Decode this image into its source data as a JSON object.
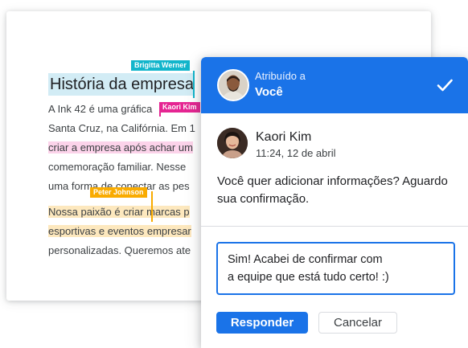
{
  "document": {
    "title": "História da empresa",
    "lines": [
      {
        "normal": "A Ink 42 é uma gráfica",
        "highlight": ""
      },
      {
        "normal": "Santa Cruz, na Califórnia. Em 1",
        "highlight": ""
      },
      {
        "normal": "",
        "highlight": "criar a empresa após achar um"
      },
      {
        "normal": "comemoração familiar. Nesse",
        "highlight": ""
      },
      {
        "normal": "uma forma de conectar as pes",
        "highlight": ""
      },
      {
        "highlight_pre": "Nossa paixão é criar",
        "highlight_post": "marcas p"
      },
      {
        "highlight": "esportivas e eventos empresar"
      },
      {
        "normal": "personalizadas. Queremos ate"
      }
    ],
    "collaborators": [
      {
        "name": "Brigitta Werner",
        "color": "#12b5cb"
      },
      {
        "name": "Kaori Kim",
        "color": "#e52592"
      },
      {
        "name": "Peter Johnson",
        "color": "#f9ab00"
      }
    ]
  },
  "panel": {
    "assigned_label": "Atribuído a",
    "assigned_to": "Você",
    "comment": {
      "author": "Kaori Kim",
      "time": "11:24, 12 de abril",
      "text": "Você quer adicionar informações? Aguardo sua confirmação."
    },
    "reply_text": "Sim! Acabei de confirmar com\na equipe que está tudo certo! :)",
    "reply_button": "Responder",
    "cancel_button": "Cancelar",
    "accent": "#1a73e8"
  }
}
